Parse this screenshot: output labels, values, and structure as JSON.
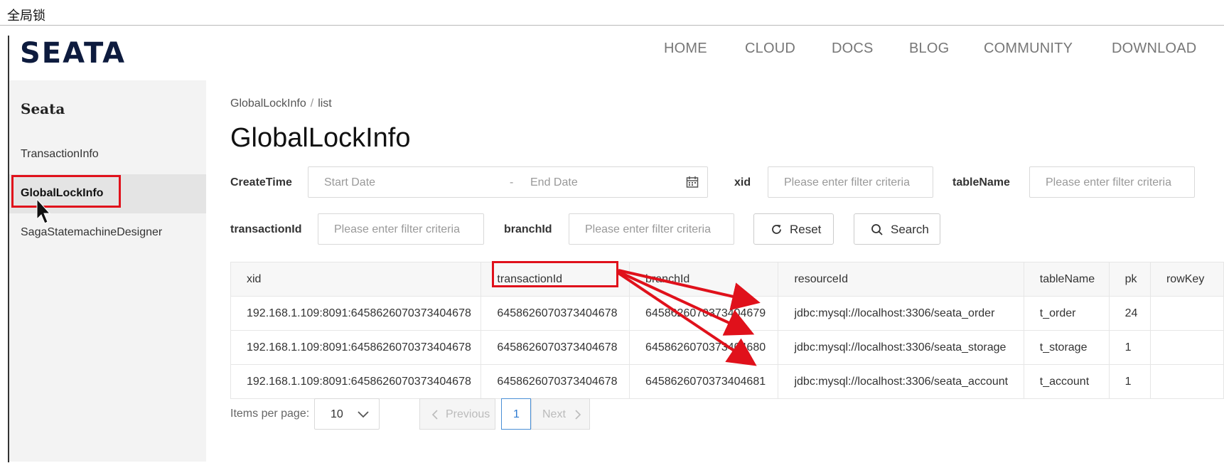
{
  "window_caption": "全局锁",
  "logo": "SEATA",
  "nav": [
    "HOME",
    "CLOUD",
    "DOCS",
    "BLOG",
    "COMMUNITY",
    "DOWNLOAD"
  ],
  "sidebar": {
    "title": "Seata",
    "items": [
      {
        "label": "TransactionInfo",
        "active": false
      },
      {
        "label": "GlobalLockInfo",
        "active": true
      },
      {
        "label": "SagaStatemachineDesigner",
        "active": false
      }
    ]
  },
  "breadcrumb": {
    "parent": "GlobalLockInfo",
    "sep": "/",
    "current": "list"
  },
  "page_title": "GlobalLockInfo",
  "filters": {
    "create_time_label": "CreateTime",
    "start_date_placeholder": "Start Date",
    "range_sep": "-",
    "end_date_placeholder": "End Date",
    "xid_label": "xid",
    "xid_placeholder": "Please enter filter criteria",
    "table_name_label": "tableName",
    "table_name_placeholder": "Please enter filter criteria",
    "transaction_id_label": "transactionId",
    "transaction_id_placeholder": "Please enter filter criteria",
    "branch_id_label": "branchId",
    "branch_id_placeholder": "Please enter filter criteria",
    "reset_label": "Reset",
    "search_label": "Search"
  },
  "table": {
    "columns": [
      "xid",
      "transactionId",
      "branchId",
      "resourceId",
      "tableName",
      "pk",
      "rowKey"
    ],
    "rows": [
      [
        "192.168.1.109:8091:6458626070373404678",
        "6458626070373404678",
        "6458626070373404679",
        "jdbc:mysql://localhost:3306/seata_order",
        "t_order",
        "24",
        ""
      ],
      [
        "192.168.1.109:8091:6458626070373404678",
        "6458626070373404678",
        "6458626070373404680",
        "jdbc:mysql://localhost:3306/seata_storage",
        "t_storage",
        "1",
        ""
      ],
      [
        "192.168.1.109:8091:6458626070373404678",
        "6458626070373404678",
        "6458626070373404681",
        "jdbc:mysql://localhost:3306/seata_account",
        "t_account",
        "1",
        ""
      ]
    ]
  },
  "pagination": {
    "items_per_page_label": "Items per page:",
    "page_size": "10",
    "previous": "Previous",
    "current_page": "1",
    "next": "Next"
  },
  "colors": {
    "annotation_red": "#e0111b",
    "accent_blue": "#2d7bd1",
    "logo_navy": "#0d1b3e"
  }
}
